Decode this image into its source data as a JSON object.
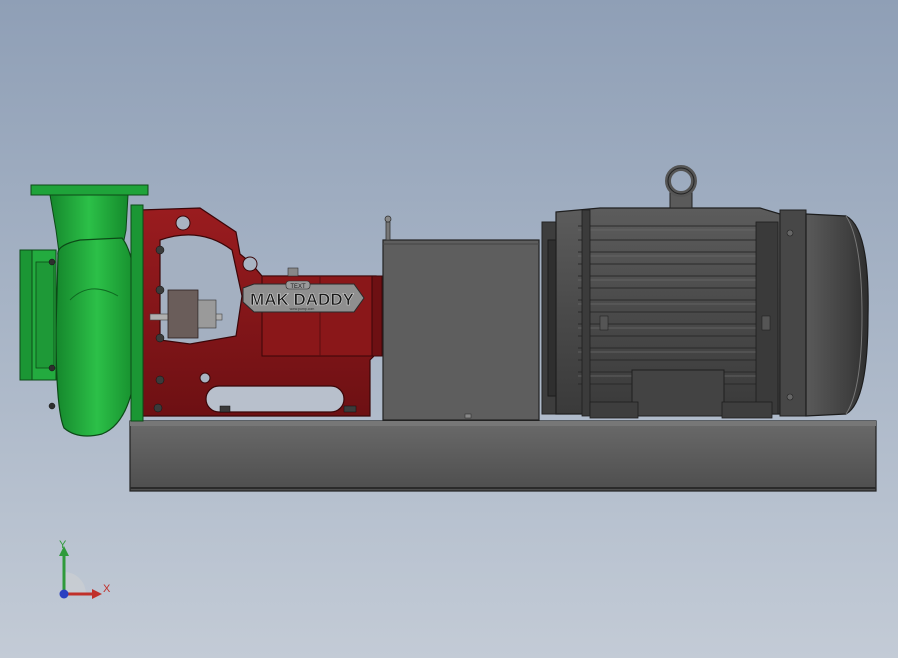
{
  "model": {
    "nameplate_badge": "TEXT",
    "brand_label": "MAK DADDY",
    "subtitle": "www.pump.com"
  },
  "triad": {
    "x_label": "X",
    "y_label": "Y"
  },
  "colors": {
    "pump_casing": "#1fa33a",
    "bearing_frame": "#8b1518",
    "coupling_guard": "#5e5e5e",
    "motor": "#4d4d4d",
    "base": "#5a5a5a",
    "axis_x": "#c0302a",
    "axis_y": "#2f9a3a",
    "axis_z": "#2a3fc0"
  }
}
